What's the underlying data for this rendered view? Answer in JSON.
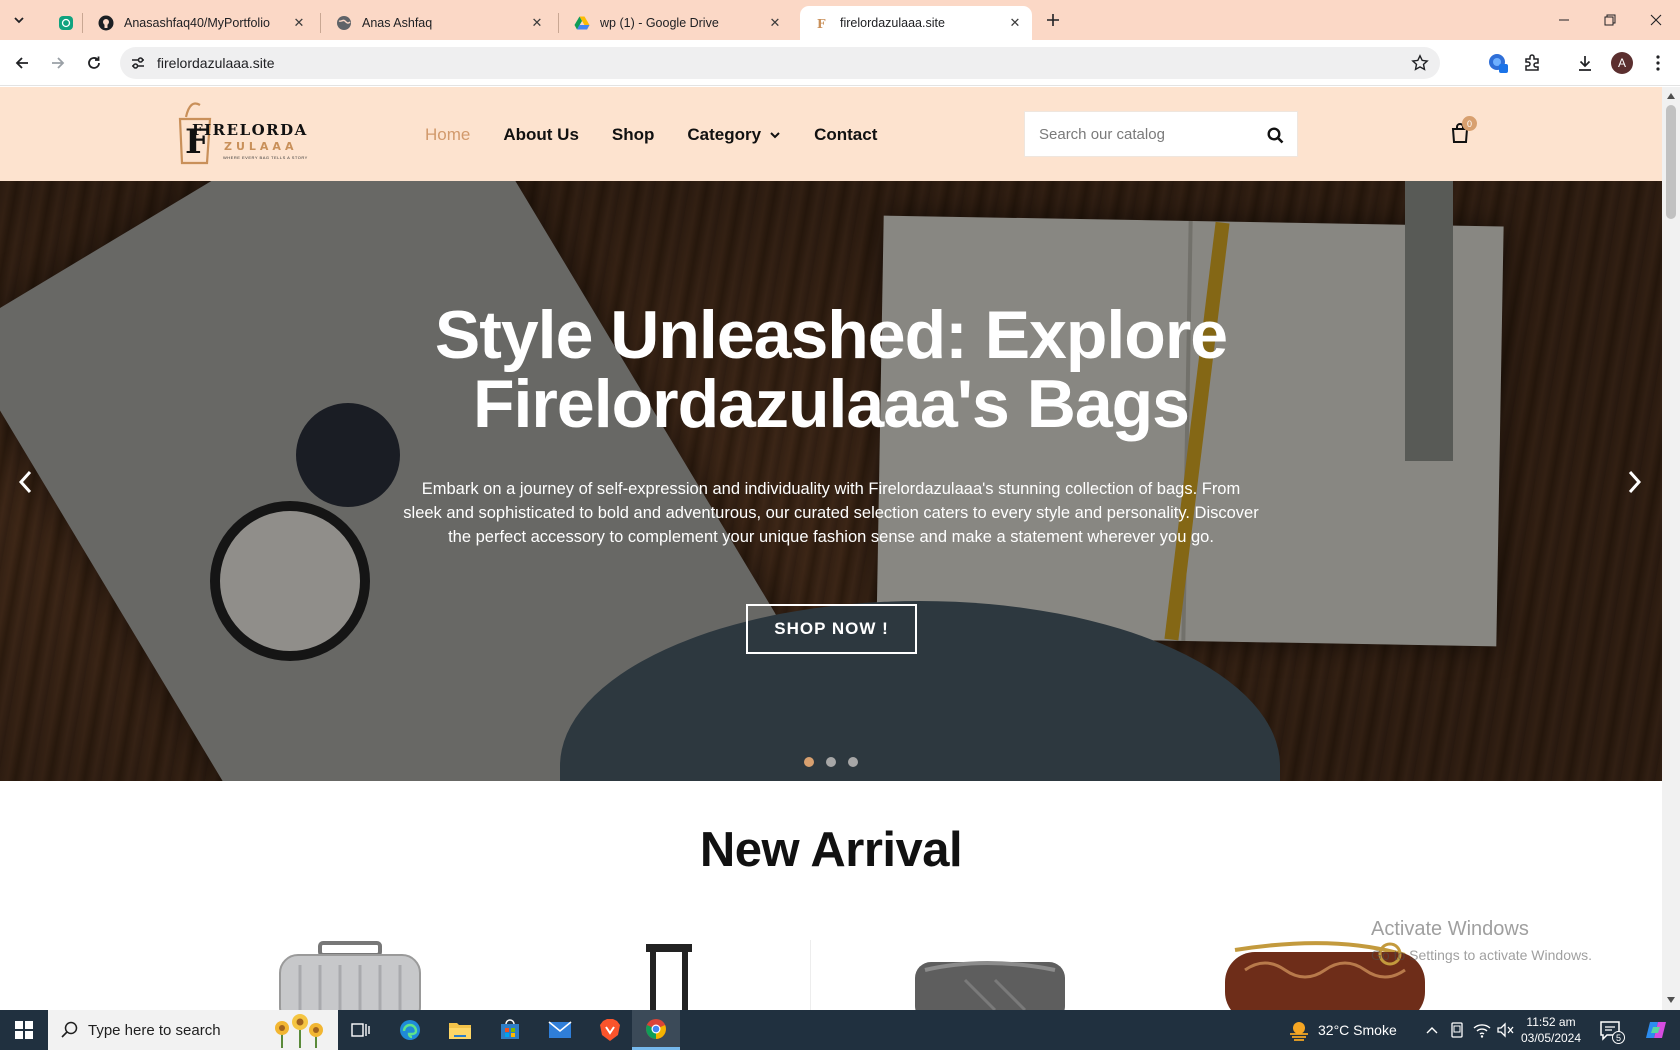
{
  "browser": {
    "tabs": [
      {
        "title": "",
        "icon": "chatgpt-icon"
      },
      {
        "title": "Anasashfaq40/MyPortfolio",
        "icon": "github-icon"
      },
      {
        "title": "Anas Ashfaq",
        "icon": "globe-icon"
      },
      {
        "title": "wp (1) - Google Drive",
        "icon": "google-drive-icon"
      },
      {
        "title": "firelordazulaaa.site",
        "icon": "site-favicon",
        "active": true
      }
    ],
    "url": "firelordazulaaa.site",
    "profile_initial": "A"
  },
  "site": {
    "logo": {
      "line1": "FIRELORDA",
      "line2": "ZULAAA",
      "tagline": "WHERE EVERY BAG TELLS A STORY"
    },
    "nav": [
      {
        "label": "Home",
        "active": true
      },
      {
        "label": "About Us"
      },
      {
        "label": "Shop"
      },
      {
        "label": "Category",
        "has_dropdown": true
      },
      {
        "label": "Contact"
      }
    ],
    "search_placeholder": "Search our catalog",
    "cart_count": "0",
    "hero": {
      "title": "Style Unleashed: Explore Firelordazulaaa's Bags",
      "description": "Embark on a journey of self-expression and individuality with Firelordazulaaa's stunning collection of bags. From sleek and sophisticated to bold and adventurous, our curated selection caters to every style and personality. Discover the perfect accessory to complement your unique fashion sense and make a statement wherever you go.",
      "cta": "SHOP NOW !",
      "slide_count": 3,
      "active_slide": 1
    },
    "new_arrival_title": "New Arrival"
  },
  "watermark": {
    "line1": "Activate Windows",
    "line2": "Go to Settings to activate Windows."
  },
  "taskbar": {
    "search_placeholder": "Type here to search",
    "weather": "32°C  Smoke",
    "time": "11:52 am",
    "date": "03/05/2024",
    "notification_count": "5"
  },
  "colors": {
    "tabstrip": "#fbd8c6",
    "site_header": "#fde3cf",
    "accent": "#d29a6c",
    "taskbar": "#20303f"
  }
}
